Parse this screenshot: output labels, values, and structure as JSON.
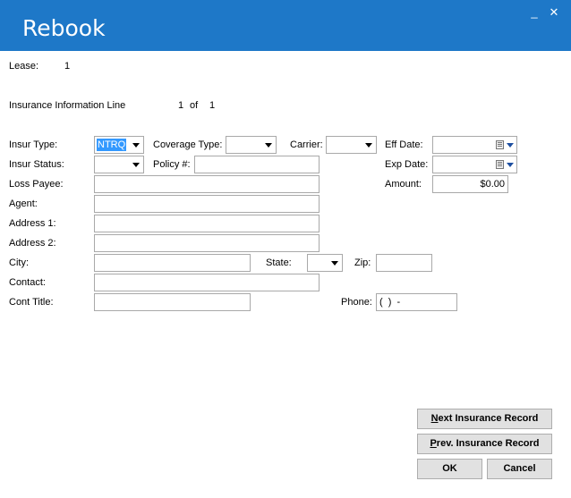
{
  "window": {
    "title": "Rebook",
    "minimize": "_",
    "close": "✕"
  },
  "lease": {
    "label": "Lease:",
    "value": "1"
  },
  "info_line": {
    "label": "Insurance Information Line",
    "current": "1",
    "of": "of",
    "total": "1"
  },
  "form": {
    "insur_type": {
      "label": "Insur Type:",
      "value": "NTRQ"
    },
    "coverage_type": {
      "label": "Coverage Type:",
      "value": ""
    },
    "carrier": {
      "label": "Carrier:",
      "value": ""
    },
    "eff_date": {
      "label": "Eff Date:",
      "value": ""
    },
    "insur_status": {
      "label": "Insur Status:",
      "value": ""
    },
    "policy": {
      "label": "Policy #:",
      "value": ""
    },
    "exp_date": {
      "label": "Exp Date:",
      "value": ""
    },
    "loss_payee": {
      "label": "Loss Payee:",
      "value": ""
    },
    "amount": {
      "label": "Amount:",
      "value": "$0.00"
    },
    "agent": {
      "label": "Agent:",
      "value": ""
    },
    "address1": {
      "label": "Address 1:",
      "value": ""
    },
    "address2": {
      "label": "Address 2:",
      "value": ""
    },
    "city": {
      "label": "City:",
      "value": ""
    },
    "state": {
      "label": "State:",
      "value": ""
    },
    "zip": {
      "label": "Zip:",
      "value": ""
    },
    "contact": {
      "label": "Contact:",
      "value": ""
    },
    "cont_title": {
      "label": "Cont Title:",
      "value": ""
    },
    "phone": {
      "label": "Phone:",
      "value": "(  )  -"
    }
  },
  "buttons": {
    "next_first": "N",
    "next_rest": "ext Insurance Record",
    "prev_first": "P",
    "prev_rest": "rev. Insurance Record",
    "ok": "OK",
    "cancel": "Cancel"
  }
}
